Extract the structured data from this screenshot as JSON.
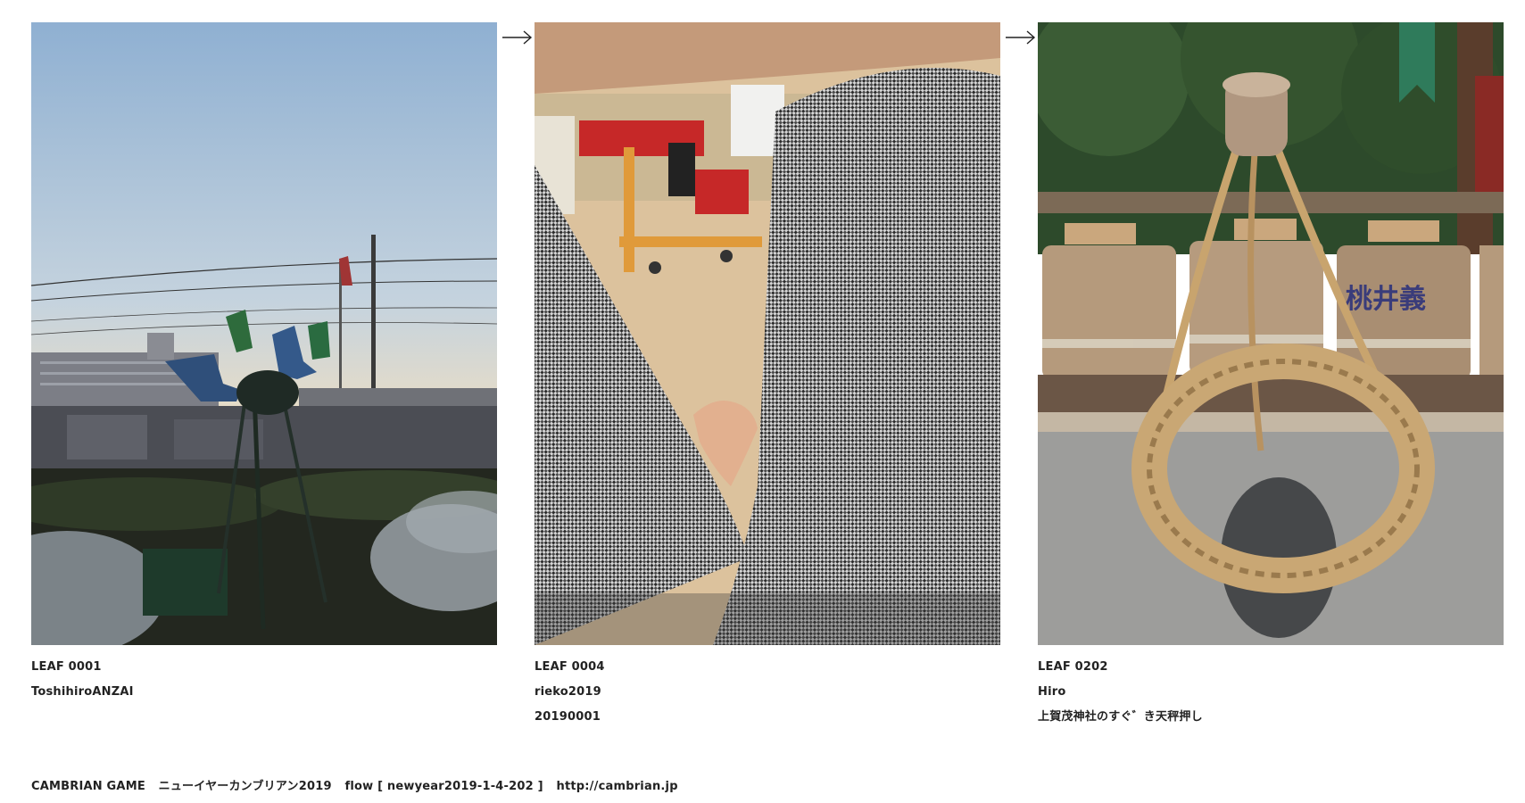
{
  "leaves": [
    {
      "id": "LEAF 0001",
      "author": "ToshihiroANZAI",
      "note": ""
    },
    {
      "id": "LEAF 0004",
      "author": "rieko2019",
      "note": "20190001"
    },
    {
      "id": "LEAF 0202",
      "author": "Hiro",
      "note": "上賀茂神社のすぐ゛き天秤押し"
    }
  ],
  "arrow_glyph": "→",
  "barrel_text": "桃井義",
  "footer": {
    "game": "CAMBRIAN GAME",
    "title": "ニューイヤーカンブリアン2019",
    "flow": "flow [ newyear2019-1-4-202 ]",
    "url": "http://cambrian.jp"
  },
  "colors": {
    "text": "#222222",
    "background": "#ffffff"
  }
}
